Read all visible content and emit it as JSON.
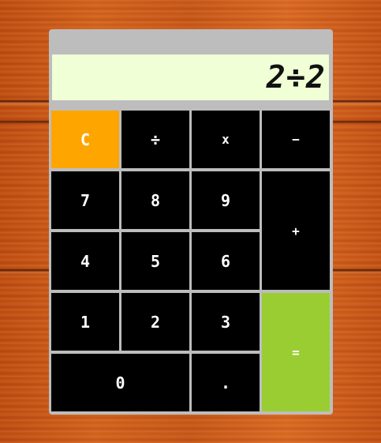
{
  "display": {
    "expression": "2÷2"
  },
  "keys": {
    "clear": "C",
    "divide": "÷",
    "multiply": "x",
    "subtract": "−",
    "seven": "7",
    "eight": "8",
    "nine": "9",
    "add": "+",
    "four": "4",
    "five": "5",
    "six": "6",
    "one": "1",
    "two": "2",
    "three": "3",
    "equals": "=",
    "zero": "0",
    "decimal": "."
  },
  "colors": {
    "clear_key": "#ffa500",
    "equals_key": "#9acd32",
    "display_bg": "#f0ffd5",
    "key_bg": "#000000",
    "frame": "#bdbdbd"
  }
}
